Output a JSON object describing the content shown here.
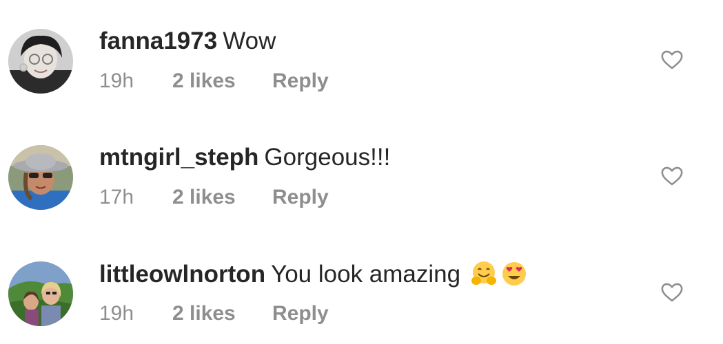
{
  "comments": [
    {
      "username": "fanna1973",
      "text": "Wow",
      "time": "19h",
      "likes": "2 likes",
      "reply": "Reply",
      "avatar_icon": "avatar-woman-glasses",
      "emojis": []
    },
    {
      "username": "mtngirl_steph",
      "text": "Gorgeous!!!",
      "time": "17h",
      "likes": "2 likes",
      "reply": "Reply",
      "avatar_icon": "avatar-woman-hat-sunglasses",
      "emojis": []
    },
    {
      "username": "littleowlnorton",
      "text": "You look amazing",
      "time": "19h",
      "likes": "2 likes",
      "reply": "Reply",
      "avatar_icon": "avatar-two-women-outdoors",
      "emojis": [
        "hugging-face-emoji",
        "heart-eyes-emoji"
      ]
    }
  ],
  "icons": {
    "like": "heart-outline-icon"
  },
  "colors": {
    "text": "#262626",
    "secondary": "#8e8e8e",
    "background": "#ffffff"
  }
}
